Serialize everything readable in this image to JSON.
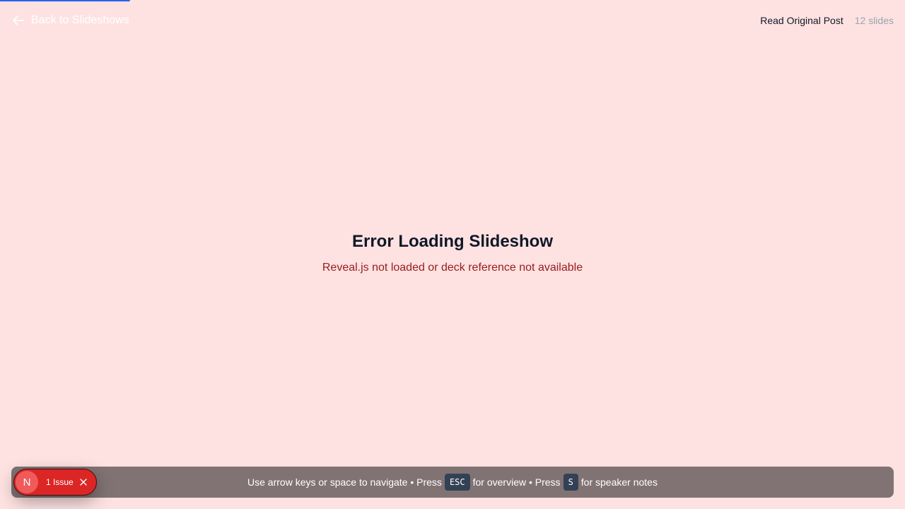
{
  "header": {
    "back_label": "Back to Slideshows",
    "read_original_label": "Read Original Post",
    "slide_count": "12 slides"
  },
  "error": {
    "title": "Error Loading Slideshow",
    "message": "Reveal.js not loaded or deck reference not available"
  },
  "help": {
    "part1": "Use arrow keys or space to navigate • Press",
    "key1": "ESC",
    "part2": "for overview • Press",
    "key2": "S",
    "part3": "for speaker notes"
  },
  "devtools": {
    "logo_letter": "N",
    "issue_label": "1 Issue"
  },
  "colors": {
    "background": "#fee2e2",
    "progress": "#2563eb",
    "error_text": "#991b1b",
    "badge": "#dc2626"
  },
  "icons": {
    "back": "arrow-left-icon",
    "close": "close-icon"
  }
}
